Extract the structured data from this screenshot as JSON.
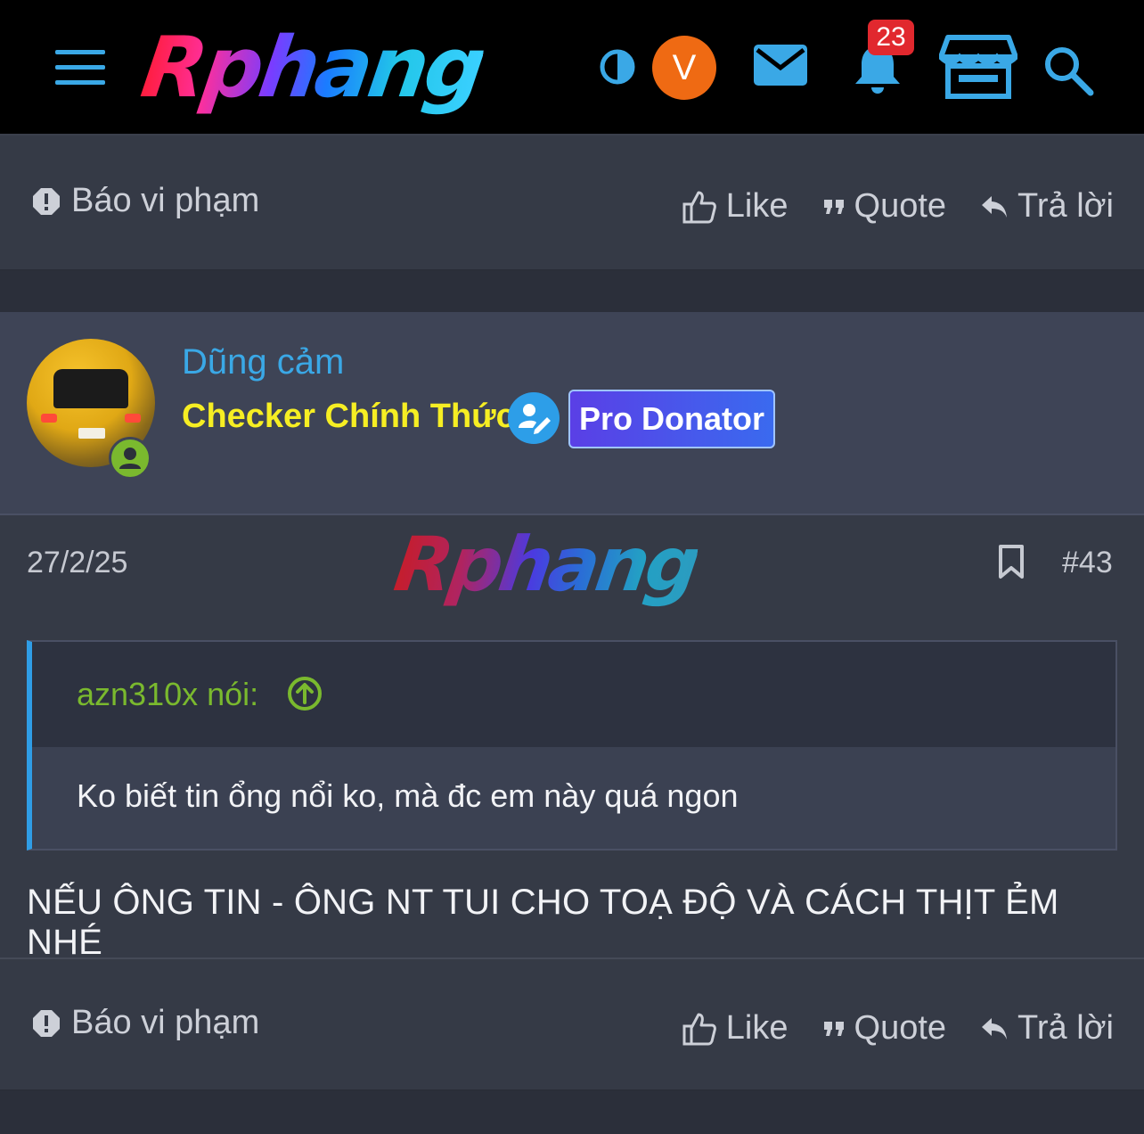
{
  "header": {
    "logo_text": "Rphang",
    "avatar_letter": "V",
    "notification_count": "23",
    "icons": [
      "menu-icon",
      "theme-toggle-icon",
      "mail-icon",
      "bell-icon",
      "store-icon",
      "search-icon"
    ],
    "colors": {
      "accent": "#3aa8e6",
      "avatar_bg": "#ef6a13",
      "badge_bg": "#e1282e"
    }
  },
  "action_bar": {
    "report_label": "Báo vi phạm",
    "like_label": "Like",
    "quote_label": "Quote",
    "reply_label": "Trả lời"
  },
  "post": {
    "username": "Dũng cảm",
    "user_title": "Checker Chính Thức",
    "badge": "Pro Donator",
    "date": "27/2/25",
    "watermark": "Rphang",
    "number": "#43",
    "quote": {
      "author": "azn310x nói:",
      "text": "Ko biết tin ổng nổi ko, mà đc em này quá ngon"
    },
    "message": "NẾU ÔNG TIN - ÔNG NT TUI CHO TOẠ ĐỘ VÀ CÁCH THỊT ẺM NHÉ"
  }
}
